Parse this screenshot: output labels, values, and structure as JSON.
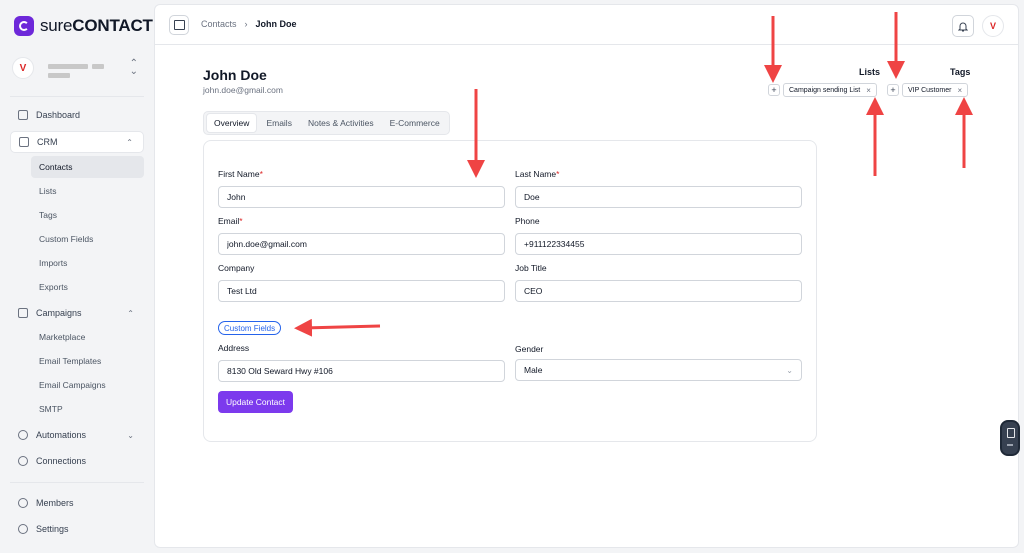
{
  "brand": {
    "prefix": "sure",
    "suffix": "CONTACT"
  },
  "workspace": {
    "avatar": "V"
  },
  "sidebar": {
    "dashboard": "Dashboard",
    "crm": "CRM",
    "crm_items": [
      "Contacts",
      "Lists",
      "Tags",
      "Custom Fields",
      "Imports",
      "Exports"
    ],
    "campaigns": "Campaigns",
    "campaign_items": [
      "Marketplace",
      "Email Templates",
      "Email Campaigns",
      "SMTP"
    ],
    "automations": "Automations",
    "connections": "Connections",
    "members": "Members",
    "settings": "Settings"
  },
  "breadcrumb": {
    "parent": "Contacts",
    "separator": "›",
    "current": "John Doe"
  },
  "user": {
    "avatar": "V"
  },
  "contact": {
    "name": "John Doe",
    "email": "john.doe@gmail.com"
  },
  "tabs": [
    "Overview",
    "Emails",
    "Notes & Activities",
    "E-Commerce"
  ],
  "form": {
    "first_name_label": "First Name",
    "first_name": "John",
    "last_name_label": "Last Name",
    "last_name": "Doe",
    "email_label": "Email",
    "email": "john.doe@gmail.com",
    "phone_label": "Phone",
    "phone": "+911122334455",
    "company_label": "Company",
    "company": "Test Ltd",
    "job_title_label": "Job Title",
    "job_title": "CEO",
    "custom_fields": "Custom Fields",
    "address_label": "Address",
    "address": "8130 Old Seward Hwy #106",
    "gender_label": "Gender",
    "gender": "Male",
    "required_mark": "*",
    "update_button": "Update Contact"
  },
  "lists": {
    "title": "Lists",
    "chip": "Campaign sending List"
  },
  "tags": {
    "title": "Tags",
    "chip": "VIP Customer"
  },
  "annotation_color": "#ef4444"
}
